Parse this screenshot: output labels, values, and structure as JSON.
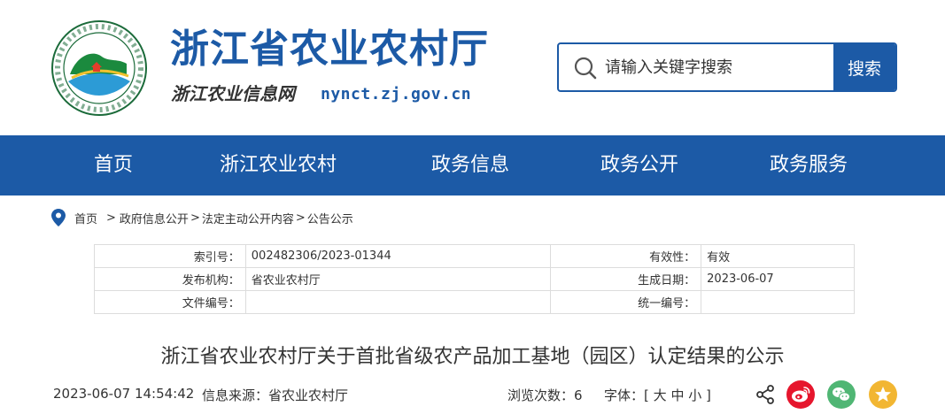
{
  "header": {
    "site_title": "浙江省农业农村厅",
    "site_subtitle": "浙江农业信息网",
    "site_url": "nynct.zj.gov.cn",
    "logo_icon": "provincial-agriculture-seal-icon"
  },
  "search": {
    "placeholder": "请输入关键字搜索",
    "value": "",
    "button_label": "搜索"
  },
  "nav": {
    "items": [
      "首页",
      "浙江农业农村",
      "政务信息",
      "政务公开",
      "政务服务"
    ]
  },
  "breadcrumb": {
    "items": [
      "首页",
      "政府信息公开",
      "法定主动公开内容",
      "公告公示"
    ],
    "separator": ">"
  },
  "meta": {
    "index_no_label": "索引号：",
    "index_no": "002482306/2023-01344",
    "validity_label": "有效性：",
    "validity": "有效",
    "issuer_label": "发布机构：",
    "issuer": "省农业农村厅",
    "date_label": "生成日期：",
    "date": "2023-06-07",
    "doc_no_label": "文件编号：",
    "doc_no": "",
    "unified_no_label": "统一编号：",
    "unified_no": ""
  },
  "article": {
    "title": "浙江省农业农村厅关于首批省级农产品加工基地（园区）认定结果的公示",
    "publish_time": "2023-06-07 14:54:42",
    "source_label": "信息来源：",
    "source": "省农业农村厅",
    "views_label": "浏览次数：",
    "views": "6",
    "font_label": "字体：",
    "font_open": "[",
    "font_large": "大",
    "font_medium": "中",
    "font_small": "小",
    "font_close": "]"
  },
  "colors": {
    "brand_blue": "#1c5aa6",
    "weibo_red": "#e6162d",
    "wechat_green": "#50b674",
    "favorite_yellow": "#f2b632"
  },
  "icons": {
    "search": "search-icon",
    "location": "location-pin-icon",
    "share": "share-icon",
    "weibo": "weibo-icon",
    "wechat": "wechat-icon",
    "favorite": "star-icon"
  }
}
